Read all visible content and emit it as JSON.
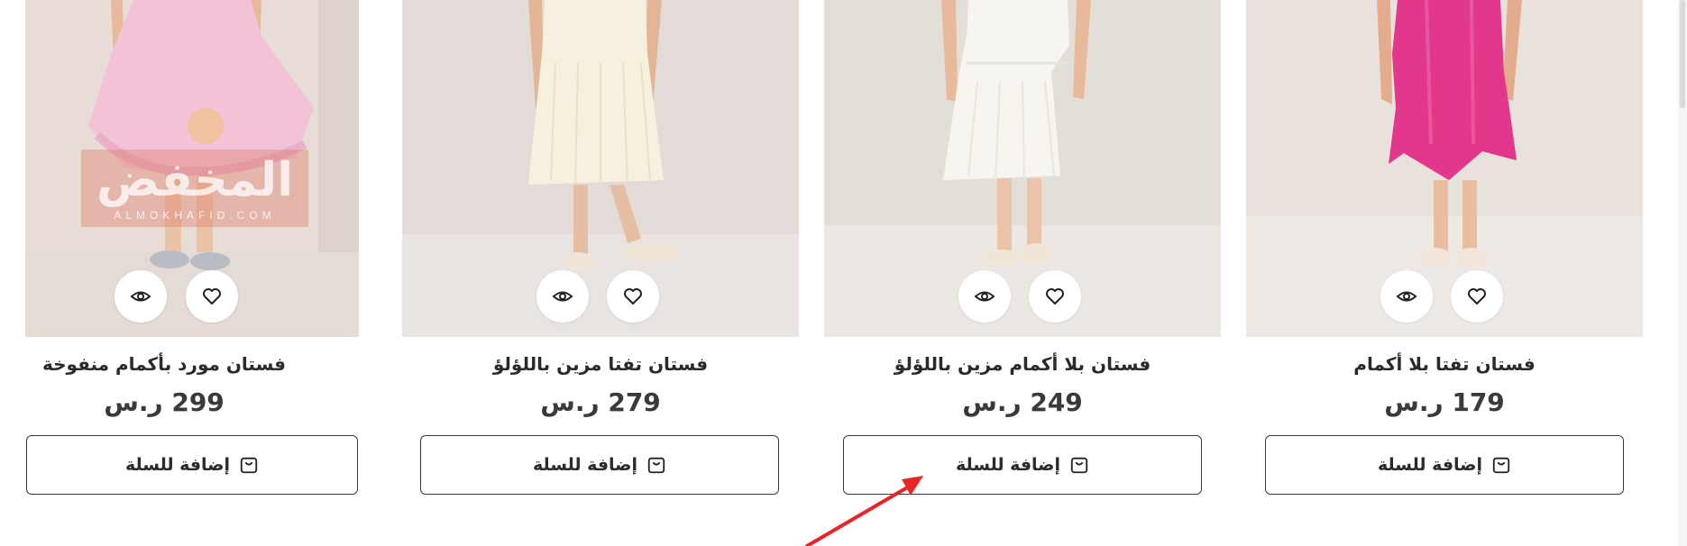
{
  "products": [
    {
      "title": "فستان مورد بأكمام منفوخة",
      "price": "299 ر.س",
      "cart_label": "إضافة للسلة",
      "dress_color": "#f2c3d6",
      "watermark": {
        "text": "المخفض",
        "subtext": "ALMOKHAFID.COM"
      }
    },
    {
      "title": "فستان تفتا مزين باللؤلؤ",
      "price": "279 ر.س",
      "cart_label": "إضافة للسلة",
      "dress_color": "#f6f0de"
    },
    {
      "title": "فستان بلا أكمام مزين باللؤلؤ",
      "price": "249 ر.س",
      "cart_label": "إضافة للسلة",
      "dress_color": "#f7f5ef"
    },
    {
      "title": "فستان تفتا بلا أكمام",
      "price": "179 ر.س",
      "cart_label": "إضافة للسلة",
      "dress_color": "#e1388c"
    }
  ],
  "icons": {
    "quick_view": "eye-icon",
    "wishlist": "heart-icon",
    "cart": "bag-icon"
  },
  "annotation": {
    "arrow_color": "#e8262a"
  }
}
